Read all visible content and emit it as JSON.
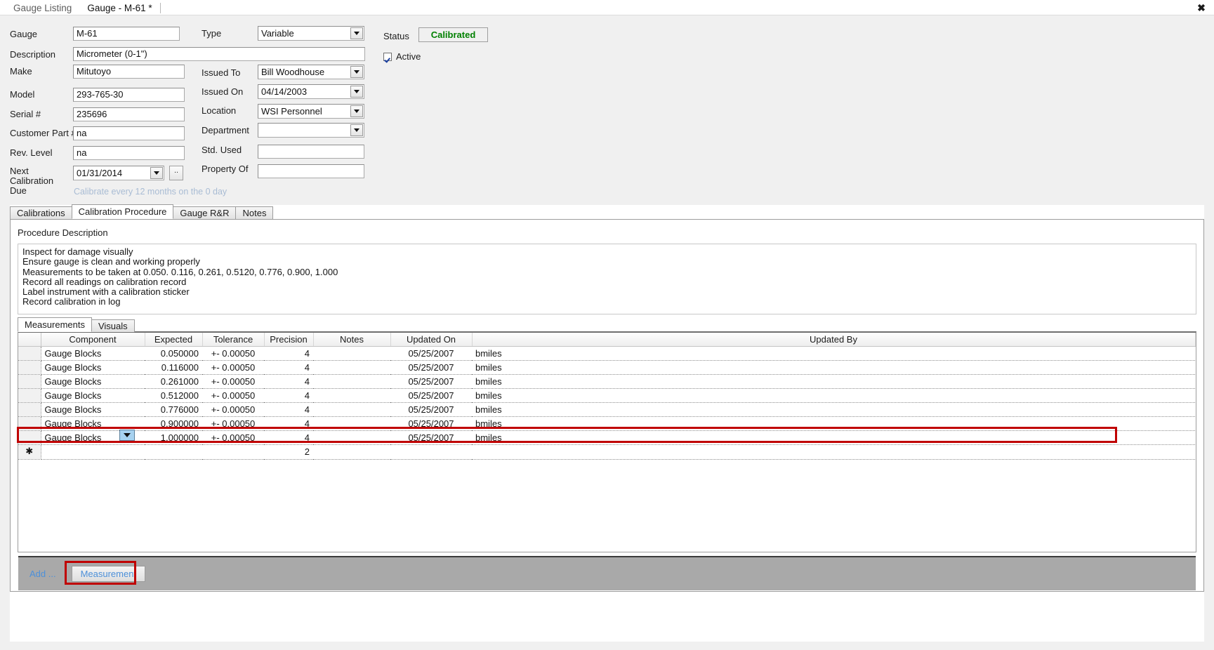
{
  "window": {
    "close_icon": "close-icon",
    "close_glyph": "✖"
  },
  "tabstrip": {
    "tabs": [
      {
        "label": "Gauge Listing",
        "active": false
      },
      {
        "label": "Gauge - M-61 *",
        "active": true
      }
    ]
  },
  "form": {
    "labels": {
      "gauge": "Gauge",
      "description": "Description",
      "make": "Make",
      "model": "Model",
      "serial": "Serial #",
      "customer_part": "Customer Part #",
      "rev_level": "Rev. Level",
      "next_calibration_due": "Next\nCalibration\nDue",
      "type": "Type",
      "issued_to": "Issued To",
      "issued_on": "Issued On",
      "location": "Location",
      "department": "Department",
      "std_used": "Std. Used",
      "property_of": "Property Of",
      "status": "Status",
      "active": "Active"
    },
    "values": {
      "gauge": "M-61",
      "description": "Micrometer (0-1\")",
      "make": "Mitutoyo",
      "model": "293-765-30",
      "serial": "235696",
      "customer_part": "na",
      "rev_level": "na",
      "next_calibration_due": "01/31/2014",
      "type": "Variable",
      "issued_to": "Bill Woodhouse",
      "issued_on": "04/14/2003",
      "location": "WSI Personnel",
      "department": "",
      "std_used": "",
      "property_of": "",
      "status": "Calibrated",
      "active_checked": true
    },
    "browse_button_label": "..",
    "calibration_hint": "Calibrate every 12 months on the 0 day",
    "status_color": "#008000",
    "hint_color": "#a9bcd4"
  },
  "mid_tabs": [
    {
      "label": "Calibrations",
      "active": false
    },
    {
      "label": "Calibration Procedure",
      "active": true
    },
    {
      "label": "Gauge R&R",
      "active": false
    },
    {
      "label": "Notes",
      "active": false
    }
  ],
  "procedure": {
    "section_label": "Procedure Description",
    "text": "Inspect for damage visually\nEnsure gauge is clean and working properly\nMeasurements to be taken at 0.050. 0.116, 0.261, 0.5120, 0.776, 0.900, 1.000\nRecord all readings on calibration record\nLabel instrument with a calibration sticker\nRecord calibration in log"
  },
  "inner_tabs": [
    {
      "label": "Measurements",
      "active": true
    },
    {
      "label": "Visuals",
      "active": false
    }
  ],
  "grid": {
    "columns": [
      "Component",
      "Expected",
      "Tolerance",
      "Precision",
      "Notes",
      "Updated On",
      "Updated By"
    ],
    "rows": [
      {
        "component": "Gauge Blocks",
        "expected": "0.050000",
        "tolerance": "+- 0.00050",
        "precision": "4",
        "notes": "",
        "updated_on": "05/25/2007",
        "updated_by": "bmiles"
      },
      {
        "component": "Gauge Blocks",
        "expected": "0.116000",
        "tolerance": "+- 0.00050",
        "precision": "4",
        "notes": "",
        "updated_on": "05/25/2007",
        "updated_by": "bmiles"
      },
      {
        "component": "Gauge Blocks",
        "expected": "0.261000",
        "tolerance": "+- 0.00050",
        "precision": "4",
        "notes": "",
        "updated_on": "05/25/2007",
        "updated_by": "bmiles"
      },
      {
        "component": "Gauge Blocks",
        "expected": "0.512000",
        "tolerance": "+- 0.00050",
        "precision": "4",
        "notes": "",
        "updated_on": "05/25/2007",
        "updated_by": "bmiles"
      },
      {
        "component": "Gauge Blocks",
        "expected": "0.776000",
        "tolerance": "+- 0.00050",
        "precision": "4",
        "notes": "",
        "updated_on": "05/25/2007",
        "updated_by": "bmiles"
      },
      {
        "component": "Gauge Blocks",
        "expected": "0.900000",
        "tolerance": "+- 0.00050",
        "precision": "4",
        "notes": "",
        "updated_on": "05/25/2007",
        "updated_by": "bmiles"
      },
      {
        "component": "Gauge Blocks",
        "expected": "1.000000",
        "tolerance": "+- 0.00050",
        "precision": "4",
        "notes": "",
        "updated_on": "05/25/2007",
        "updated_by": "bmiles"
      }
    ],
    "new_row": {
      "marker": "✱",
      "component": "",
      "expected": "",
      "tolerance": "",
      "precision": "2",
      "notes": "",
      "updated_on": "",
      "updated_by": ""
    },
    "highlight_color": "#c00000"
  },
  "footer": {
    "add_label": "Add ...",
    "measurement_button": "Measurement",
    "link_color": "#4d90d9",
    "highlight_color": "#c00000"
  }
}
